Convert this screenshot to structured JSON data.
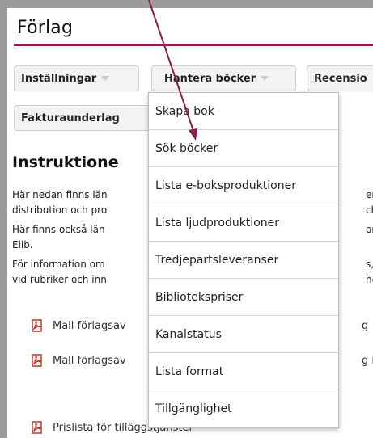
{
  "page": {
    "title": "Förlag"
  },
  "toolbar": {
    "settings_label": "Inställningar",
    "manage_books_label": "Hantera böcker",
    "reviews_label": "Recensio",
    "billing_label": "Fakturaunderlag"
  },
  "dropdown": {
    "items": [
      "Skapa bok",
      "Sök böcker",
      "Lista e-boksproduktioner",
      "Lista ljudproduktioner",
      "Tredjepartsleveranser",
      "Bibliotekspriser",
      "Kanalstatus",
      "Lista format",
      "Tillgänglighet"
    ]
  },
  "content": {
    "heading": "Instruktione",
    "p1_line1_left": "Här nedan finns län",
    "p1_line1_right": "er",
    "p1_line2_left": "distribution och pro",
    "p1_line2_right": "ch",
    "p2_line1_left": "Här finns också län",
    "p2_line1_right": "om",
    "p2_line2_left": "Elib.",
    "p3_line1_left": "För information om",
    "p3_line1_right": "s, l",
    "p3_line2_left": "vid rubriker och inn",
    "p3_line2_right": "ne",
    "links": [
      {
        "left": "Mall förlagsav",
        "right": "g"
      },
      {
        "left": "Mall förlagsav",
        "right": "g i"
      },
      {
        "left": "Prislista för tilläggstjänster",
        "right": ""
      }
    ]
  },
  "colors": {
    "accent": "#8a1d4f",
    "pdf_icon": "#c0392b"
  }
}
